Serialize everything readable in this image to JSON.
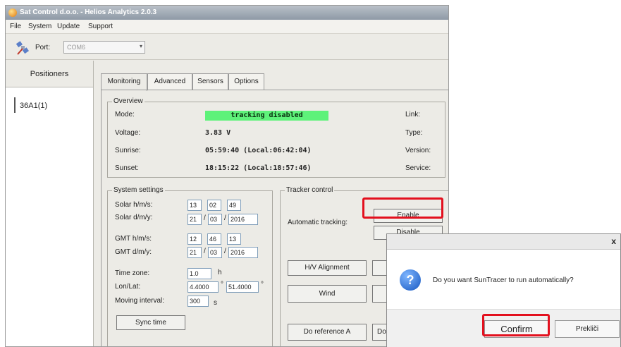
{
  "window": {
    "title": "Sat Control d.o.o. - Helios Analytics 2.0.3"
  },
  "menu": [
    "File",
    "System",
    "Update",
    "Support"
  ],
  "toolbar": {
    "port_label": "Port:",
    "port_value": "COM6"
  },
  "left_panel": {
    "header": "Positioners",
    "items": [
      "36A1(1)"
    ]
  },
  "tabs": [
    "Monitoring",
    "Advanced",
    "Sensors",
    "Options"
  ],
  "overview": {
    "title": "Overview",
    "mode_label": "Mode:",
    "mode_value": "tracking disabled",
    "voltage_label": "Voltage:",
    "voltage_value": "3.83  V",
    "sunrise_label": "Sunrise:",
    "sunrise_value": "05:59:40 (Local:06:42:04)",
    "sunset_label": "Sunset:",
    "sunset_value": "18:15:22 (Local:18:57:46)",
    "right_labels": [
      "Link:",
      "Type:",
      "Version:",
      "Service:"
    ]
  },
  "system_settings": {
    "title": "System settings",
    "solar_hms_label": "Solar h/m/s:",
    "solar_hms": [
      "13",
      "02",
      "49"
    ],
    "solar_dmy_label": "Solar d/m/y:",
    "solar_dmy": [
      "21",
      "03",
      "2016"
    ],
    "gmt_hms_label": "GMT h/m/s:",
    "gmt_hms": [
      "12",
      "46",
      "13"
    ],
    "gmt_dmy_label": "GMT d/m/y:",
    "gmt_dmy": [
      "21",
      "03",
      "2016"
    ],
    "timezone_label": "Time zone:",
    "timezone_value": "1.0",
    "timezone_unit": "h",
    "lonlat_label": "Lon/Lat:",
    "lon_value": "4.4000",
    "lat_value": "51.4000",
    "degree": "°",
    "interval_label": "Moving interval:",
    "interval_value": "300",
    "interval_unit": "s",
    "sync_button": "Sync time"
  },
  "tracker_control": {
    "title": "Tracker control",
    "auto_label": "Automatic tracking:",
    "enable_button": "Enable",
    "disable_button": "Disable",
    "hv_button": "H/V Alignment",
    "wind_button": "Wind",
    "ref_a_button": "Do reference A",
    "ref_b_button": "Do"
  },
  "dialog": {
    "close": "x",
    "message": "Do you want SunTracer to run automatically?",
    "confirm_button": "Confirm",
    "cancel_button": "Prekliči"
  },
  "colors": {
    "highlight": "#e3101e",
    "status_green": "#5ef27a"
  }
}
